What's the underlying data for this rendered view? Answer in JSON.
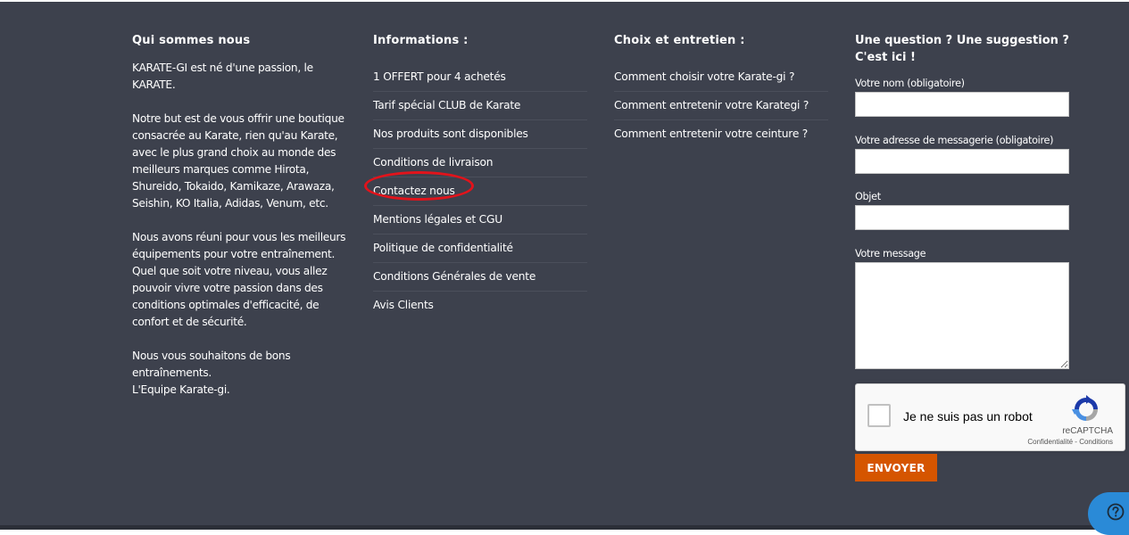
{
  "about": {
    "title": "Qui sommes nous",
    "paragraphs": [
      "KARATE-GI est né d'une passion, le KARATE.",
      "Notre but est de vous offrir une boutique consacrée au Karate, rien qu'au Karate, avec le plus grand choix au monde des meilleurs marques comme Hirota, Shureido, Tokaido, Kamikaze, Arawaza, Seishin, KO Italia, Adidas, Venum, etc.",
      "Nous avons réuni pour vous les meilleurs équipements pour votre entraînement. Quel que soit votre niveau, vous allez pouvoir vivre votre passion dans des conditions optimales d'efficacité, de confort et de sécurité.",
      "Nous vous souhaitons de bons entraînements.",
      "L'Equipe Karate-gi."
    ]
  },
  "informations": {
    "title": "Informations :",
    "links": [
      "1 OFFERT pour 4 achetés",
      "Tarif spécial CLUB de Karate",
      "Nos produits sont disponibles",
      "Conditions de livraison",
      "Contactez nous",
      "Mentions légales et CGU",
      "Politique de confidentialité",
      "Conditions Générales de vente",
      "Avis Clients"
    ]
  },
  "care": {
    "title": "Choix et entretien :",
    "links": [
      "Comment choisir votre Karate-gi ?",
      "Comment entretenir votre Karategi ?",
      "Comment entretenir votre ceinture ?"
    ]
  },
  "form": {
    "title": "Une question ? Une suggestion ? C'est ici !",
    "name_label": "Votre nom (obligatoire)",
    "name_value": "",
    "email_label": "Votre adresse de messagerie (obligatoire)",
    "email_value": "",
    "subject_label": "Objet",
    "subject_value": "",
    "message_label": "Votre message",
    "message_value": "",
    "submit_label": "ENVOYER"
  },
  "recaptcha": {
    "label": "Je ne suis pas un robot",
    "brand": "reCAPTCHA",
    "privacy": "Confidentialité",
    "separator": " - ",
    "terms": "Conditions"
  },
  "colors": {
    "footer_bg": "#3d414d",
    "accent_button": "#d55500",
    "highlight_ring": "#e2131b",
    "help_bubble": "#2a8ad7"
  },
  "icons": {
    "captcha_logo": "recaptcha-logo-icon",
    "help": "help-icon"
  }
}
